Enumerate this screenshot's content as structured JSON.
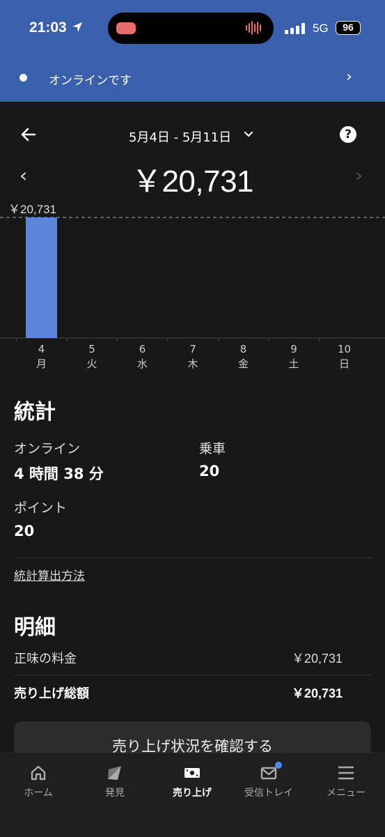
{
  "status": {
    "time": "21:03",
    "network": "5G",
    "battery": "96"
  },
  "banner": {
    "text": "オンラインです",
    "chevron": "›"
  },
  "header": {
    "range": "5月4日 - 5月11日",
    "help": "?",
    "prev": "‹",
    "next": "›",
    "total": "￥20,731"
  },
  "chart_data": {
    "type": "bar",
    "max_label": "￥20,731",
    "categories": [
      {
        "num": "4",
        "dow": "月"
      },
      {
        "num": "5",
        "dow": "火"
      },
      {
        "num": "6",
        "dow": "水"
      },
      {
        "num": "7",
        "dow": "木"
      },
      {
        "num": "8",
        "dow": "金"
      },
      {
        "num": "9",
        "dow": "土"
      },
      {
        "num": "10",
        "dow": "日"
      }
    ],
    "values": [
      20731,
      0,
      0,
      0,
      0,
      0,
      0
    ],
    "ylim": [
      0,
      20731
    ],
    "bar_color": "#5b85d8"
  },
  "stats": {
    "title": "統計",
    "online_label": "オンライン",
    "online_value": "4 時間 38 分",
    "rides_label": "乗車",
    "rides_value": "20",
    "points_label": "ポイント",
    "points_value": "20",
    "method_link": "統計算出方法"
  },
  "details": {
    "title": "明細",
    "net_label": "正味の料金",
    "net_value": "￥20,731",
    "gross_label": "売り上げ総額",
    "gross_value": "￥20,731",
    "cta": "売り上げ状況を確認する"
  },
  "nav": [
    {
      "label": "ホーム",
      "icon": "home-icon"
    },
    {
      "label": "発見",
      "icon": "discover-icon"
    },
    {
      "label": "売り上げ",
      "icon": "earnings-icon",
      "active": true
    },
    {
      "label": "受信トレイ",
      "icon": "mail-icon",
      "badge": true
    },
    {
      "label": "メニュー",
      "icon": "menu-icon"
    }
  ],
  "colors": {
    "accent": "#3a5fad",
    "bar": "#5b85d8",
    "badge": "#4a8df0"
  }
}
